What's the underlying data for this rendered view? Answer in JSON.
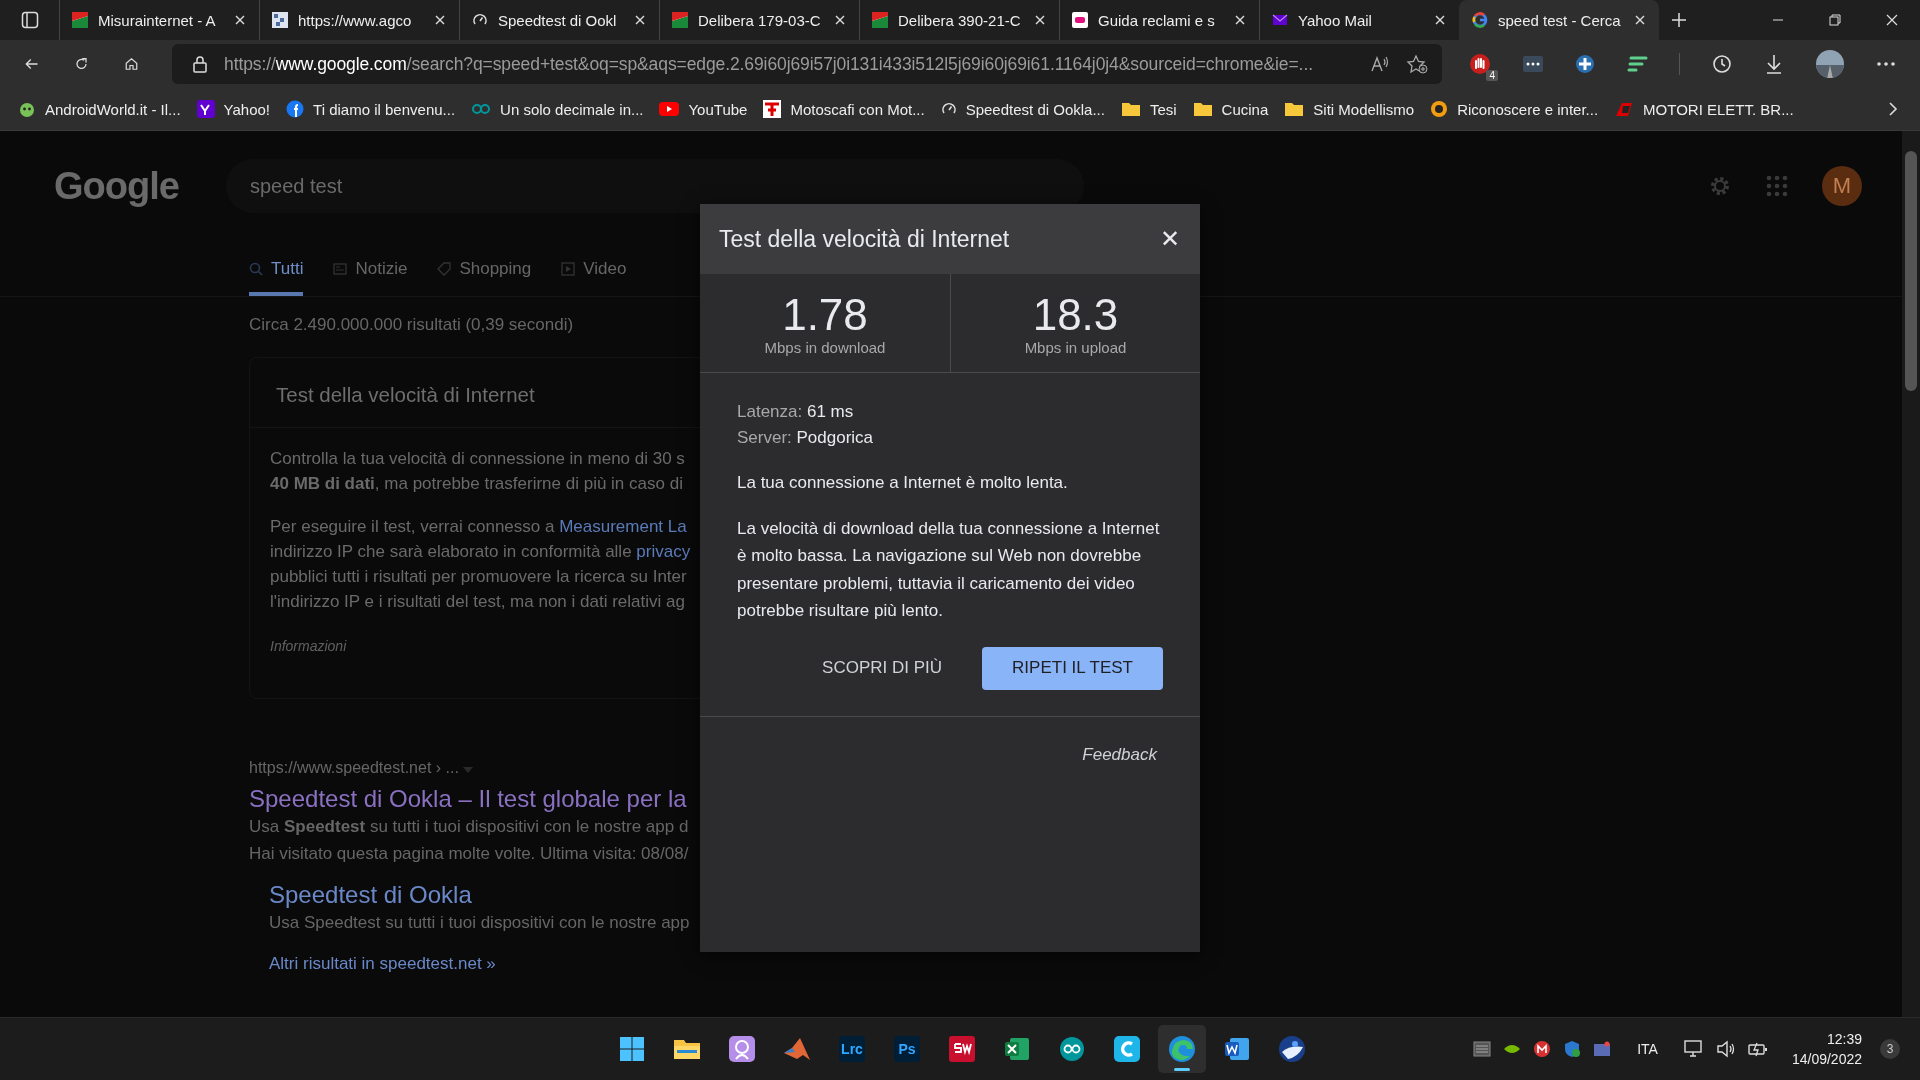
{
  "tabs": [
    {
      "title": "Misurainternet - A",
      "kind": "flag",
      "selected": false
    },
    {
      "title": "https://www.agco",
      "kind": "grid",
      "selected": false
    },
    {
      "title": "Speedtest di Ookl",
      "kind": "gauge",
      "selected": false
    },
    {
      "title": "Delibera 179-03-C",
      "kind": "flag",
      "selected": false
    },
    {
      "title": "Delibera 390-21-C",
      "kind": "flag",
      "selected": false
    },
    {
      "title": "Guida reclami e s",
      "kind": "sky",
      "selected": false
    },
    {
      "title": "Yahoo Mail",
      "kind": "mail",
      "selected": false
    },
    {
      "title": "speed test - Cerca",
      "kind": "google",
      "selected": true
    }
  ],
  "address": {
    "host_prefix": "https://",
    "host": "www.google.com",
    "rest": "/search?q=speed+test&oq=sp&aqs=edge.2.69i60j69i57j0i131i433i512l5j69i60j69i61.1164j0j4&sourceid=chrome&ie=..."
  },
  "extension_badge": "4",
  "bookmarks": [
    {
      "label": "AndroidWorld.it - Il...",
      "kind": "android"
    },
    {
      "label": "Yahoo!",
      "kind": "yahoo"
    },
    {
      "label": "Ti diamo il benvenu...",
      "kind": "facebook"
    },
    {
      "label": "Un solo decimale in...",
      "kind": "arduino"
    },
    {
      "label": "YouTube",
      "kind": "youtube"
    },
    {
      "label": "Motoscafi con Mot...",
      "kind": "boat"
    },
    {
      "label": "Speedtest di Ookla...",
      "kind": "gauge"
    },
    {
      "label": "Tesi",
      "kind": "folder"
    },
    {
      "label": "Cucina",
      "kind": "folder"
    },
    {
      "label": "Siti Modellismo",
      "kind": "folder"
    },
    {
      "label": "Riconoscere e inter...",
      "kind": "aperture"
    },
    {
      "label": "MOTORI ELETT. BR...",
      "kind": "logo"
    }
  ],
  "google": {
    "logo": "Google",
    "query": "speed test",
    "avatar": "M",
    "tabs": [
      {
        "label": "Tutti",
        "selected": true
      },
      {
        "label": "Notizie",
        "selected": false
      },
      {
        "label": "Shopping",
        "selected": false
      },
      {
        "label": "Video",
        "selected": false
      }
    ],
    "result_count": "Circa 2.490.000.000 risultati (0,39 secondi)",
    "card": {
      "title": "Test della velocità di Internet",
      "paragraph_1": [
        "Controlla la tua velocità di connessione in meno di 30 s",
        "**40 MB di dati**, ma potrebbe trasferirne di più in caso di"
      ],
      "paragraph_2": [
        {
          "text": "Per eseguire il test, verrai connesso a ",
          "link": "Measurement La"
        },
        {
          "text": "indirizzo IP che sarà elaborato in conformità alle ",
          "link": "privacy"
        },
        {
          "text": "pubblici tutti i risultati per promuovere la ricerca su Inter"
        },
        {
          "text": "l'indirizzo IP e i risultati del test, ma non i dati relativi ag"
        }
      ],
      "info": "Informazioni"
    },
    "result": {
      "url": "https://www.speedtest.net › ...",
      "title": "Speedtest di Ookla – Il test globale per la",
      "snippet": "Usa **Speedtest** su tutti i tuoi dispositivi con le nostre app d",
      "visited": "Hai visitato questa pagina molte volte. Ultima visita: 08/08/",
      "sitelink": {
        "title": "Speedtest di Ookla",
        "snippet": "Usa Speedtest su tutti i tuoi dispositivi con le nostre app"
      },
      "more": "Altri risultati in speedtest.net »"
    }
  },
  "dialog": {
    "title": "Test della velocità di Internet",
    "close": "✕",
    "stats": [
      {
        "value": "1.78",
        "label": "Mbps in download"
      },
      {
        "value": "18.3",
        "label": "Mbps in upload"
      }
    ],
    "details": [
      {
        "label": "Latenza:",
        "value": "61 ms"
      },
      {
        "label": "Server:",
        "value": "Podgorica"
      }
    ],
    "verdict": "La tua connessione a Internet è molto lenta.",
    "explanation": "La velocità di download della tua connessione a Internet è molto bassa. La navigazione sul Web non dovrebbe presentare problemi, tuttavia il caricamento dei video potrebbe risultare più lento.",
    "buttons": [
      {
        "label": "SCOPRI DI PIÙ",
        "kind": "text"
      },
      {
        "label": "RIPETI IL TEST",
        "kind": "primary"
      }
    ],
    "feedback": "Feedback"
  },
  "taskbar": {
    "apps": [
      {
        "kind": "windows",
        "selected": false
      },
      {
        "kind": "folder",
        "selected": false
      },
      {
        "kind": "portrait",
        "selected": false
      },
      {
        "kind": "matlab",
        "selected": false
      },
      {
        "kind": "letters",
        "label": "Lrc",
        "color": "#31a8ff",
        "selected": false
      },
      {
        "kind": "letters",
        "label": "Ps",
        "color": "#31a8ff",
        "selected": false
      },
      {
        "kind": "solidworks",
        "selected": false
      },
      {
        "kind": "excel",
        "selected": false
      },
      {
        "kind": "arduino",
        "selected": false
      },
      {
        "kind": "cura",
        "selected": false
      },
      {
        "kind": "edge",
        "selected": true
      },
      {
        "kind": "word",
        "selected": false
      },
      {
        "kind": "globe",
        "selected": false
      }
    ],
    "language": "ITA",
    "time": "12:39",
    "date": "14/09/2022",
    "notifications": "3"
  }
}
